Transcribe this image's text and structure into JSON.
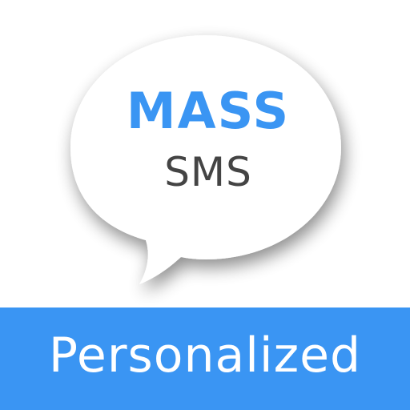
{
  "bubble": {
    "title": "MASS",
    "subtitle": "SMS"
  },
  "banner": {
    "label": "Personalized"
  },
  "icons": {
    "bubble": "speech-bubble-icon"
  },
  "colors": {
    "accent": "#3a95f3",
    "subtitle": "#444444",
    "bubble_fill": "#ffffff",
    "background": "#ffffff",
    "banner_text": "#ffffff"
  }
}
